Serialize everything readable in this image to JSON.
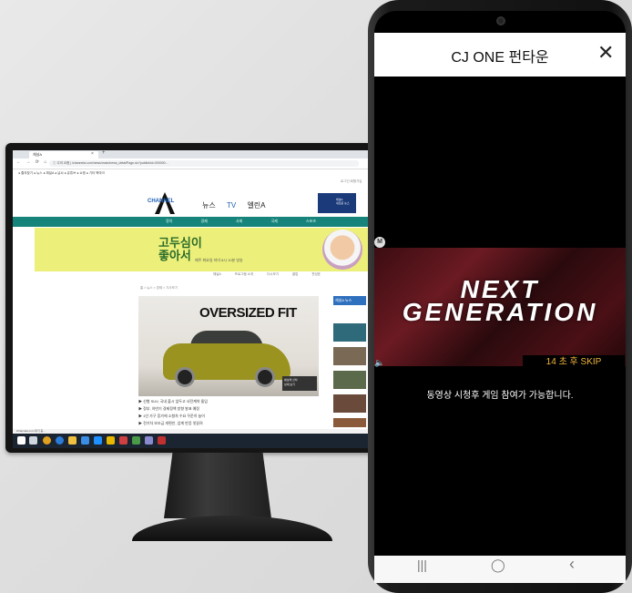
{
  "monitor": {
    "browser": {
      "tab_title": "채널A",
      "tab_close": "×",
      "tab_new": "+",
      "nav_buttons": "← → ⟳ ⌂",
      "url": "ⓘ 주의 요함 | ichannela.com/news/main/news_detailPage.do?publishId=000000...",
      "bookmarks": "● 즐겨찾기   ● 뉴스   ● 채널A   ● 날씨   ● 유튜브   ● 쇼핑   ● 기타 북마크"
    },
    "site": {
      "top_links": "로그인  회원가입",
      "logo_text": "CHANNEL",
      "nav": [
        "뉴스",
        "TV",
        "엘린A"
      ],
      "ad_text": "채널A\n새로운 뉴스",
      "menu": [
        "정치",
        "경제",
        "사회",
        "국제",
        "스포츠",
        "연예"
      ],
      "banner_title": "고두심이\n좋아서",
      "banner_sub": "매주 화요일 저녁 8시 10분 방송",
      "subnav": [
        "채널A",
        "프로그램 소개",
        "다시보기",
        "클립",
        "편성표"
      ],
      "breadcrumb": "홈 > 뉴스 > 경제 > 기사보기",
      "ad_headline": "OVERSIZED FIT",
      "ad_caption": "쉐보레 신차\n상세 보기",
      "article_lines": [
        "▶ 신형 SUV, 국내 출시 앞두고 사전계약 돌입",
        "▶ 정부, 하반기 경제정책 방향 발표 예정",
        "▶ 1인 가구 증가에 소형차 수요 꾸준히 늘어",
        "▶ 전기차 보조금 개편안, 업계 반응 엇갈려"
      ],
      "sidebar_head": "채널A 뉴스"
    },
    "statusline": "ichannela.com 대기 중..."
  },
  "phone": {
    "app_title": "CJ ONE 펀타운",
    "close_label": "✕",
    "video_text": "NEXT GENERATION",
    "badge": "M",
    "volume": "🔈",
    "skip_label": "14 초 후 SKIP",
    "notice": "동영상 시청후 게임 참여가 가능합니다.",
    "nav_keys": [
      "|||",
      "◯",
      "‹"
    ]
  }
}
